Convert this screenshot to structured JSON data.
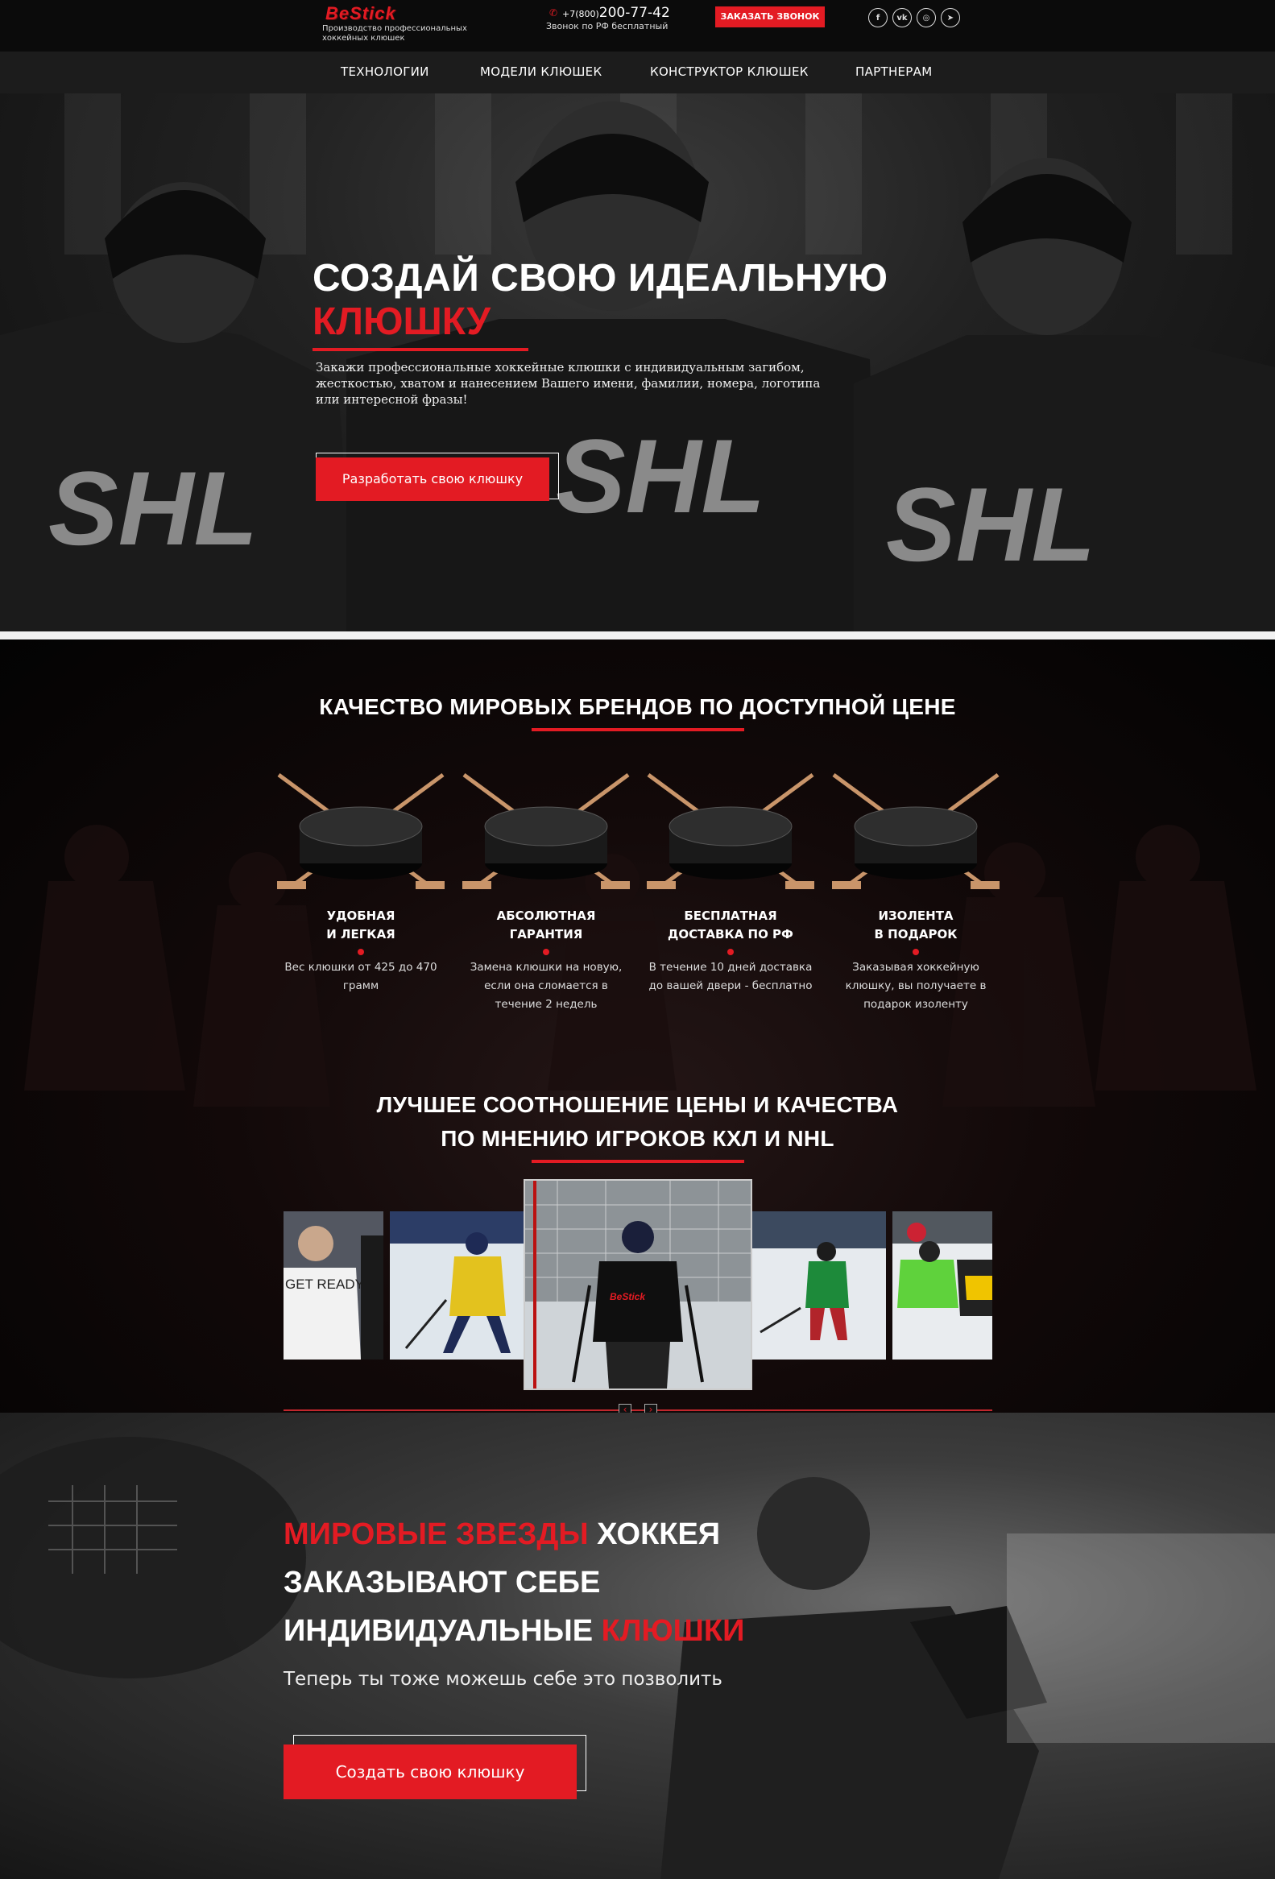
{
  "brand": {
    "logo": "BeStick",
    "tagline": "Производство профессиональных хоккейных клюшек",
    "accent_color": "#e31b23"
  },
  "header": {
    "phone_prefix": "+7(800)",
    "phone_number": "200-77-42",
    "phone_note": "Звонок по РФ бесплатный",
    "callback_button": "ЗАКАЗАТЬ ЗВОНОК",
    "socials": [
      {
        "icon": "facebook-icon",
        "glyph": "f"
      },
      {
        "icon": "vk-icon",
        "glyph": "vk"
      },
      {
        "icon": "instagram-icon",
        "glyph": "◎"
      },
      {
        "icon": "telegram-icon",
        "glyph": "➤"
      }
    ]
  },
  "nav": {
    "items": [
      "ТЕХНОЛОГИИ",
      "МОДЕЛИ КЛЮШЕК",
      "КОНСТРУКТОР КЛЮШЕК",
      "ПАРТНЕРАМ"
    ]
  },
  "hero": {
    "title_line1": "СОЗДАЙ СВОЮ ИДЕАЛЬНУЮ",
    "title_line2": "КЛЮШКУ",
    "description": "Закажи профессиональные хоккейные клюшки с индивидуальным загибом, жесткостью, хватом и нанесением Вашего имени, фамилии, номера, логотипа или интересной фразы!",
    "button": "Разработать свою клюшку",
    "jersey_text": "SHL"
  },
  "quality": {
    "heading": "КАЧЕСТВО МИРОВЫХ БРЕНДОВ ПО ДОСТУПНОЙ ЦЕНЕ",
    "features": [
      {
        "title_1": "УДОБНАЯ",
        "title_2": "И ЛЕГКАЯ",
        "text": "Вес клюшки от 425 до 470 грамм",
        "icon": "crossed-sticks-puck-icon"
      },
      {
        "title_1": "АБСОЛЮТНАЯ",
        "title_2": "ГАРАНТИЯ",
        "text": "Замена клюшки на новую, если она сломается в течение 2 недель",
        "icon": "crossed-sticks-puck-icon"
      },
      {
        "title_1": "БЕСПЛАТНАЯ",
        "title_2": "ДОСТАВКА ПО РФ",
        "text": "В течение 10 дней доставка до вашей двери - бесплатно",
        "icon": "crossed-sticks-puck-icon"
      },
      {
        "title_1": "ИЗОЛЕНТА",
        "title_2": "В ПОДАРОК",
        "text": "Заказывая хоккейную клюшку, вы получаете в подарок изоленту",
        "icon": "crossed-sticks-puck-icon"
      }
    ]
  },
  "players": {
    "heading_1": "ЛУЧШЕЕ СООТНОШЕНИЕ ЦЕНЫ И КАЧЕСТВА",
    "heading_2": "ПО МНЕНИЮ ИГРОКОВ КХЛ И NHL",
    "shirt_text": "GET READY FOR GOLD",
    "center_shirt_logo": "BeStick",
    "prev_arrow": "‹",
    "next_arrow": "›"
  },
  "stars": {
    "line1_red": "МИРОВЫЕ ЗВЕЗДЫ",
    "line1_white": " ХОККЕЯ",
    "line2": "ЗАКАЗЫВАЮТ СЕБЕ",
    "line3_white": "ИНДИВИДУАЛЬНЫЕ ",
    "line3_red": "КЛЮШКИ",
    "subtitle": "Теперь ты тоже можешь себе это позволить",
    "button": "Создать свою клюшку"
  }
}
